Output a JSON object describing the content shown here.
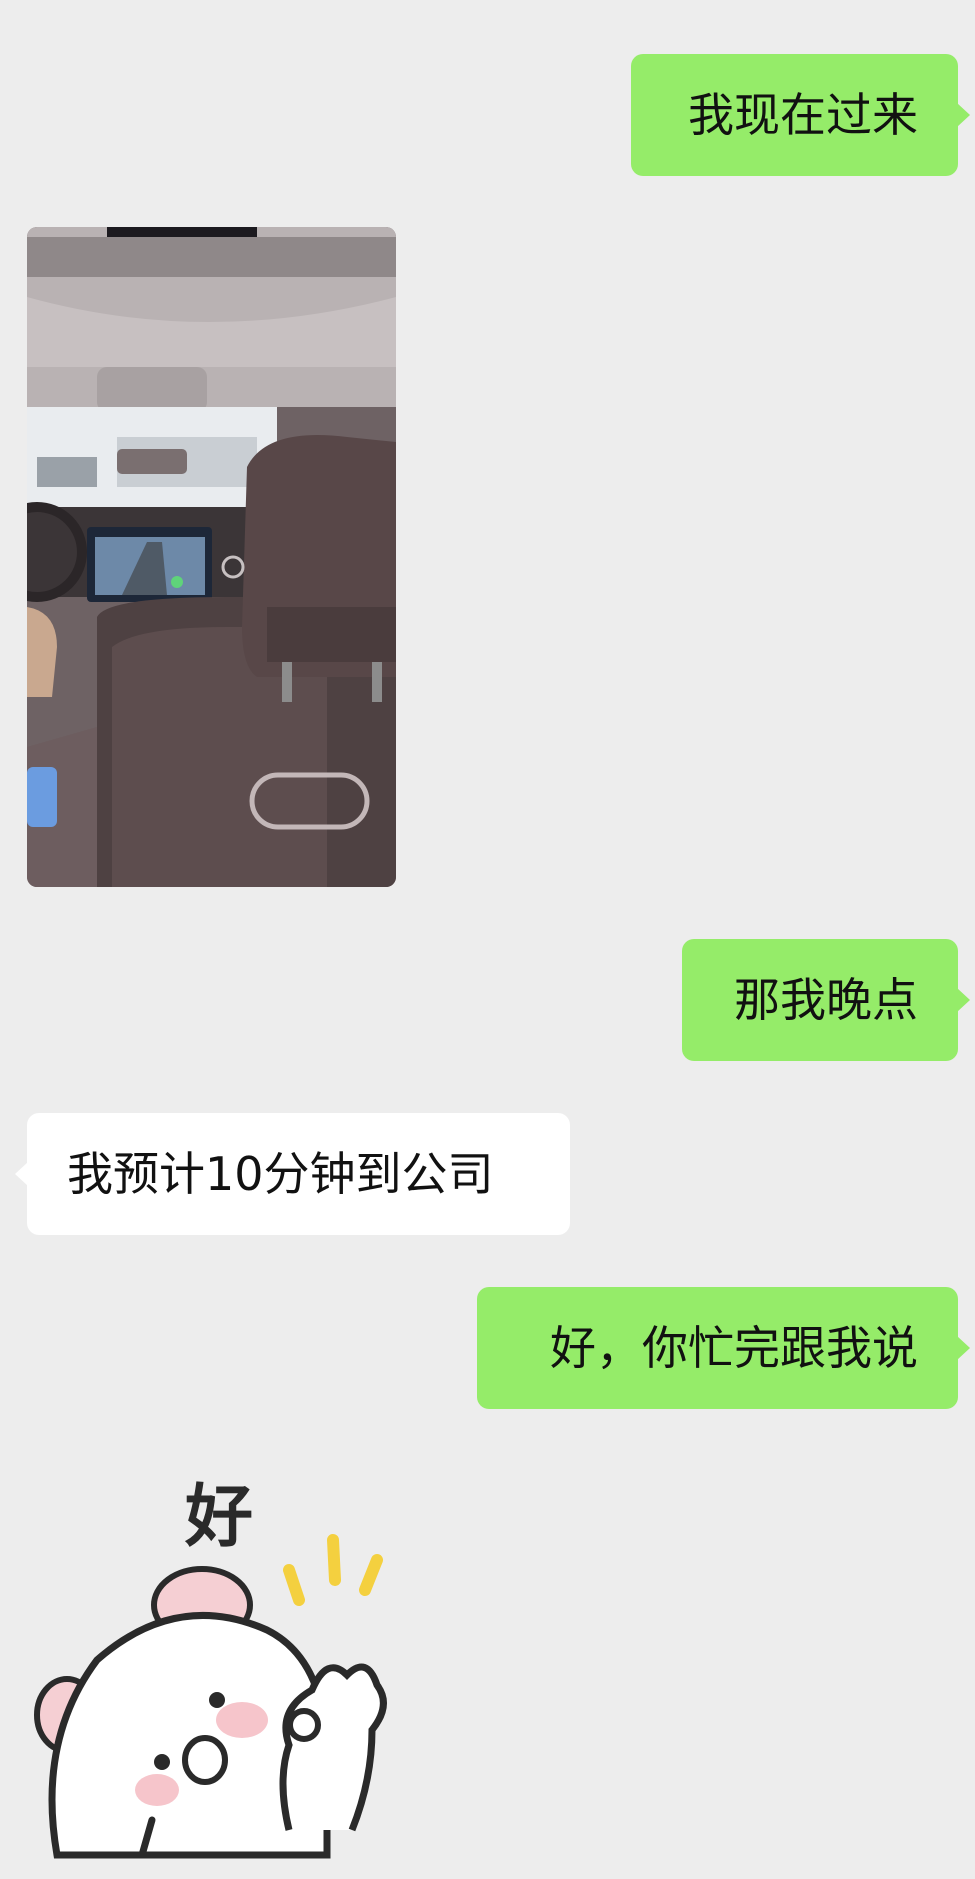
{
  "messages": [
    {
      "side": "out",
      "type": "text",
      "text": "我现在过来"
    },
    {
      "side": "in",
      "type": "image",
      "image_icon": "car-interior-photo"
    },
    {
      "side": "out",
      "type": "text",
      "text": "那我晚点"
    },
    {
      "side": "in",
      "type": "text",
      "text": "我预计10分钟到公司"
    },
    {
      "side": "out",
      "type": "text",
      "text": "好，你忙完跟我说"
    },
    {
      "side": "in",
      "type": "sticker",
      "sticker_icon": "ok-hamster-sticker",
      "sticker_text": "好"
    }
  ],
  "colors": {
    "background": "#ededed",
    "outgoing_bubble": "#95ec69",
    "incoming_bubble": "#ffffff",
    "text": "#111111"
  }
}
